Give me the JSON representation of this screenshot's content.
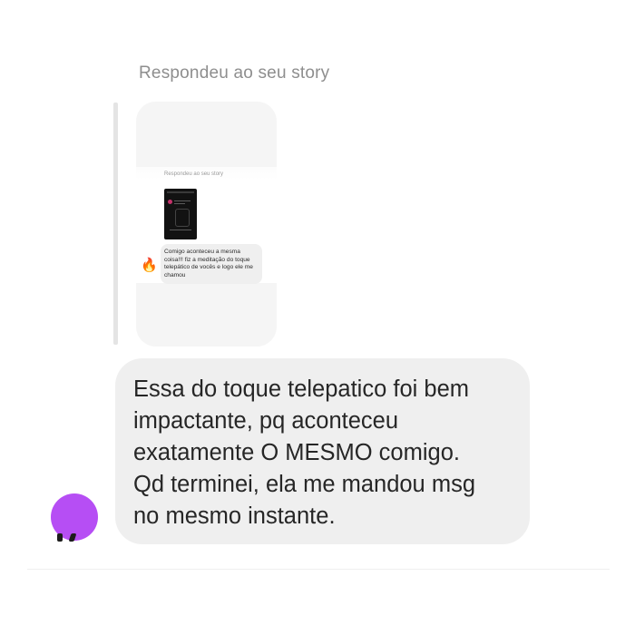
{
  "reply": {
    "header": "Respondeu ao seu story"
  },
  "story_preview": {
    "header": "Respondeu ao seu story",
    "message": "Comigo aconteceu a mesma coisa!!! fiz a meditação do toque telepático de vocês e logo ele me chamou",
    "reaction_emoji": "🔥",
    "reaction_icon": "fire-emoji-icon"
  },
  "message": {
    "lines": [
      "Essa do toque telepatico foi bem",
      "impactante, pq aconteceu",
      "exatamente O MESMO comigo.",
      "Qd terminei, ela me mandou msg",
      "no mesmo instante."
    ]
  },
  "colors": {
    "bubble": "#efefef",
    "avatar": "#b64ef4",
    "meta_text": "#8e8e8e",
    "text": "#262626"
  }
}
